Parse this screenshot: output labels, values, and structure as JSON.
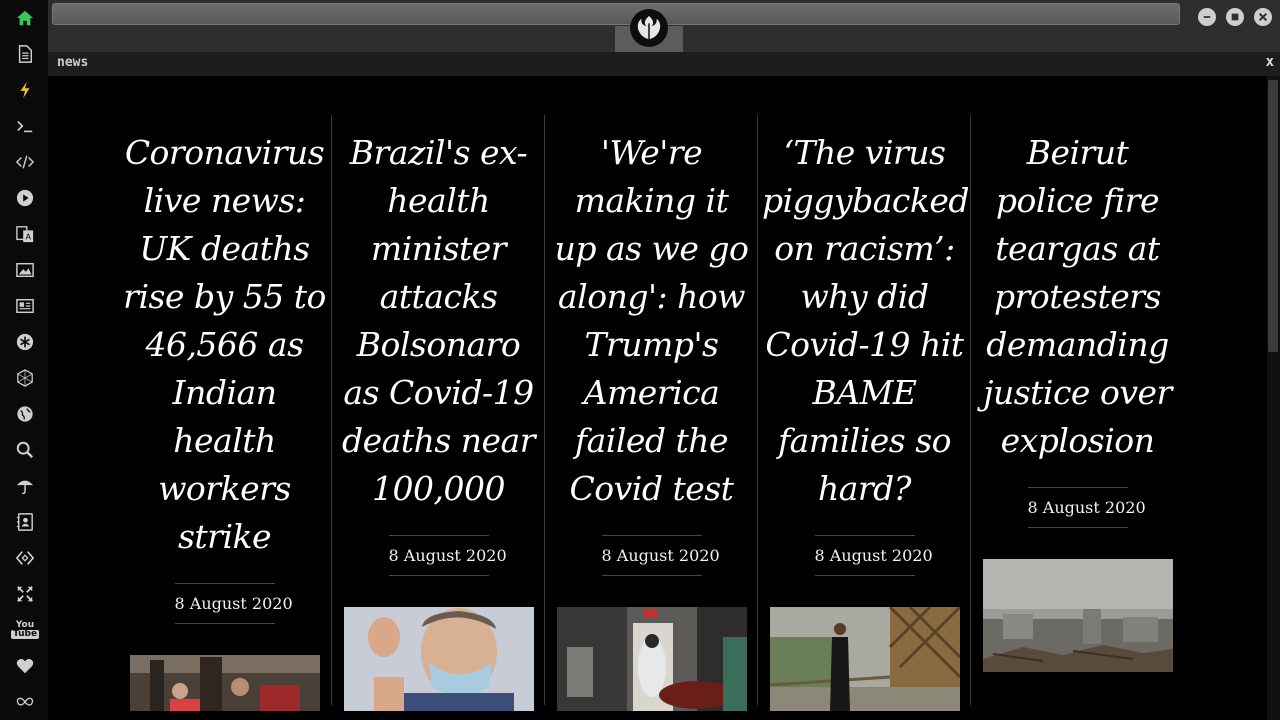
{
  "tab": {
    "title": "news",
    "close_label": "x"
  },
  "sidebar": {
    "items": [
      {
        "icon": "home-icon",
        "color": "#3ec45c"
      },
      {
        "icon": "document-icon",
        "color": "#cfcfcf"
      },
      {
        "icon": "lightning-icon",
        "color": "#f2c230"
      },
      {
        "icon": "terminal-icon",
        "color": "#cfcfcf"
      },
      {
        "icon": "code-icon",
        "color": "#cfcfcf"
      },
      {
        "icon": "play-icon",
        "color": "#cfcfcf"
      },
      {
        "icon": "translate-icon",
        "color": "#cfcfcf"
      },
      {
        "icon": "image-icon",
        "color": "#cfcfcf"
      },
      {
        "icon": "newspaper-icon",
        "color": "#cfcfcf"
      },
      {
        "icon": "asterisk-icon",
        "color": "#cfcfcf"
      },
      {
        "icon": "hexagon-icon",
        "color": "#cfcfcf"
      },
      {
        "icon": "globe-icon",
        "color": "#cfcfcf"
      },
      {
        "icon": "search-icon",
        "color": "#cfcfcf"
      },
      {
        "icon": "umbrella-icon",
        "color": "#cfcfcf"
      },
      {
        "icon": "contacts-icon",
        "color": "#cfcfcf"
      },
      {
        "icon": "tag-code-icon",
        "color": "#cfcfcf"
      },
      {
        "icon": "expand-icon",
        "color": "#cfcfcf"
      },
      {
        "icon": "youtube-icon",
        "color": "#cfcfcf",
        "text": "You Tube"
      },
      {
        "icon": "heart-icon",
        "color": "#cfcfcf"
      },
      {
        "icon": "infinity-icon",
        "color": "#cfcfcf"
      }
    ]
  },
  "window": {
    "logo_icon": "rebel-alliance-icon",
    "controls": [
      "minimize-icon",
      "maximize-icon",
      "close-icon"
    ]
  },
  "articles": [
    {
      "headline": "Coronavirus live news: UK deaths rise by 55 to 46,566 as Indian health workers strike",
      "date": "8 August 2020",
      "image_desc": "protest-photo"
    },
    {
      "headline": "Brazil's ex-health minister attacks Bolsonaro as Covid-19 deaths near 100,000",
      "date": "8 August 2020",
      "image_desc": "bolsonaro-photo"
    },
    {
      "headline": "'We're making it up as we go along': how Trump's America failed the Covid test",
      "date": "8 August 2020",
      "image_desc": "hospital-photo"
    },
    {
      "headline": "‘The virus piggybacked on racism’: why did Covid-19 hit BAME families so hard?",
      "date": "8 August 2020",
      "image_desc": "woman-on-bridge-photo"
    },
    {
      "headline": "Beirut police fire teargas at protesters demanding justice over explosion",
      "date": "8 August 2020",
      "image_desc": "beirut-ruins-photo"
    }
  ]
}
